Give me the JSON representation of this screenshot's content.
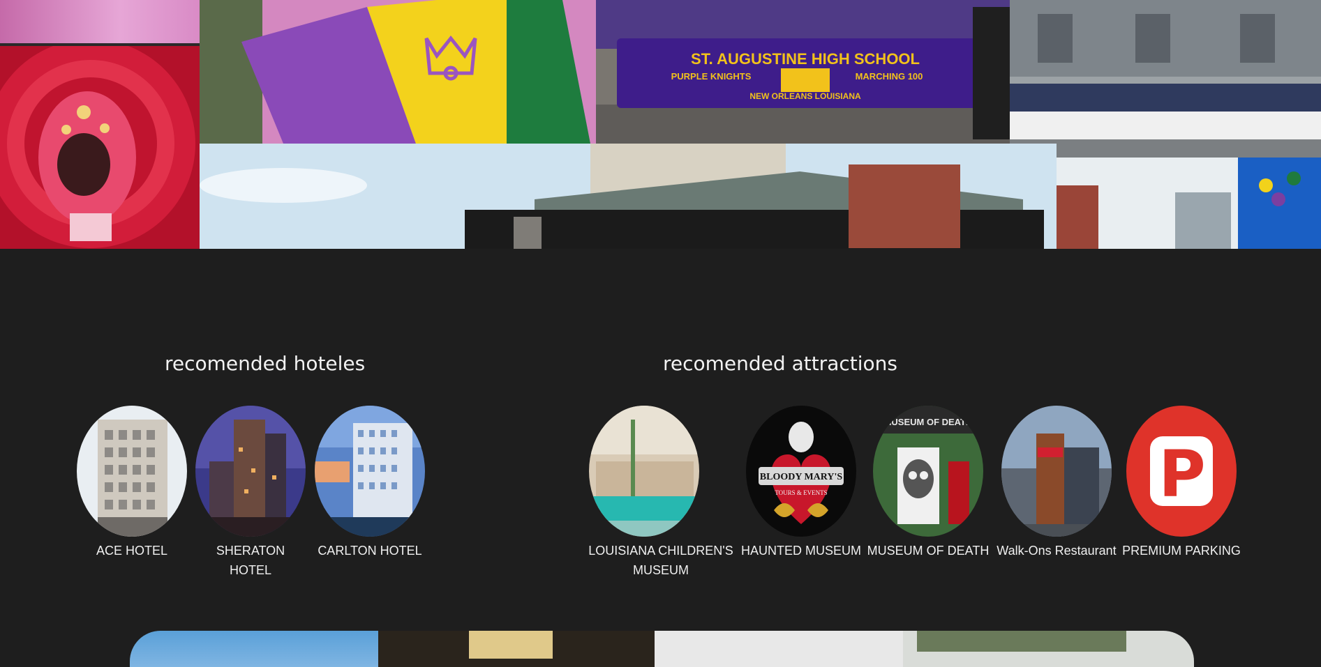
{
  "hotels": {
    "title": "recomended hoteles",
    "items": [
      {
        "label": "ACE HOTEL",
        "icon": "ace-hotel-photo"
      },
      {
        "label": "SHERATON HOTEL",
        "icon": "sheraton-hotel-photo"
      },
      {
        "label": "CARLTON HOTEL",
        "icon": "carlton-hotel-photo"
      }
    ]
  },
  "attractions": {
    "title": "recomended attractions",
    "items": [
      {
        "label": "LOUISIANA CHILDREN'S MUSEUM",
        "icon": "childrens-museum-photo"
      },
      {
        "label": "HAUNTED MUSEUM",
        "icon": "bloody-marys-logo",
        "logo_text": "BLOODY MARY'S",
        "logo_subtext": "TOURS & EVENTS"
      },
      {
        "label": "MUSEUM OF DEATH",
        "icon": "museum-of-death-photo",
        "sign_text": "MUSEUM OF DEATH"
      },
      {
        "label": "Walk-Ons Restaurant",
        "icon": "walk-ons-photo"
      },
      {
        "label": "PREMIUM PARKING",
        "icon": "parking-logo",
        "logo_letter": "P"
      }
    ]
  },
  "collage": {
    "banner_school": "ST. AUGUSTINE HIGH SCHOOL",
    "banner_left": "PURPLE KNIGHTS",
    "banner_right": "MARCHING 100",
    "banner_bottom": "NEW ORLEANS LOUISIANA"
  },
  "colors": {
    "background": "#1e1e1e",
    "text": "#f0f0f0",
    "mardi_purple": "#7b3fa0",
    "mardi_gold": "#f2d21b",
    "mardi_green": "#1f7a3d",
    "parking_red": "#e0312b"
  }
}
